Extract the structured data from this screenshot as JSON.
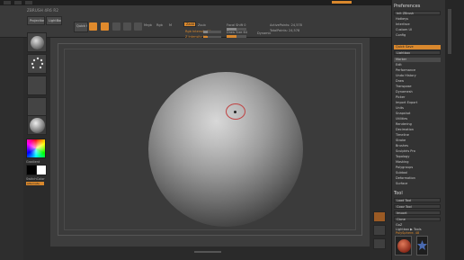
{
  "app": {
    "title": "ZBRUSH 4R6 R2"
  },
  "toolbar": {
    "buttons": [
      "Projection Master",
      "LightBox",
      "Quick Sketch"
    ],
    "edit_label": "Edit",
    "draw_label": "Draw",
    "move_label": "Move",
    "scale_label": "Scale",
    "rotate_label": "Rotate",
    "mrgb": "Mrgb",
    "rgb": "Rgb",
    "m": "M",
    "zadd": "Zadd",
    "zsub": "Zsub",
    "zcut": "Zcut",
    "rgb_intensity": "Rgb Intensity 25",
    "z_intensity": "Z Intensity 25",
    "focal_shift": "Focal Shift 0",
    "draw_size": "Draw Size 64",
    "dynamic": "Dynamic",
    "active_points": "ActivePoints: 24,578",
    "total_points": "TotalPoints: 24,578"
  },
  "toolbar_values": {
    "rgb_intensity": 25,
    "z_intensity": 25,
    "draw_size": 64
  },
  "leftbar": {
    "gradient_label": "Gradient",
    "switch_color_label": "SwitchColor",
    "alternate_label": "Alternate",
    "colors": {
      "main": "#000000",
      "secondary": "#ffffff"
    }
  },
  "panel": {
    "title": "Preferences",
    "top_items": [
      "Init ZBrush",
      "Hotkeys",
      "Interface",
      "Custom UI",
      "Config",
      "Quick Save",
      "Lightbox",
      "Mem"
    ],
    "orange_item": "Quick Save",
    "list": [
      "Marker",
      "Edit",
      "Performance",
      "Undo History",
      "Draw",
      "Transpose",
      "Dynamesh",
      "Picker",
      "Import Export",
      "Units",
      "Snapshot",
      "Utilities",
      "Rendering",
      "Decimation",
      "Timeline",
      "Stroke",
      "Brushes",
      "Sculptris Pro",
      "Topology",
      "Masking",
      "Polygroups",
      "Subtool",
      "Deformation",
      "Surface"
    ],
    "tool_title": "Tool",
    "tool_items": [
      "Load Tool",
      "Save As",
      "Copy Tool",
      "Paste Tool",
      "Import",
      "Export",
      "Clone",
      "Make PolyMesh3D",
      "GoZ",
      "All",
      "Visible",
      "R"
    ],
    "lightbox_tools": "Lightbox ▶ Tools",
    "polysphere_label": "PolySphere. 48"
  },
  "colors": {
    "accent": "#d9882d",
    "panel_bg": "#333333",
    "viewport_bg": "#3d3d3d",
    "cursor_ring": "#c04444"
  }
}
